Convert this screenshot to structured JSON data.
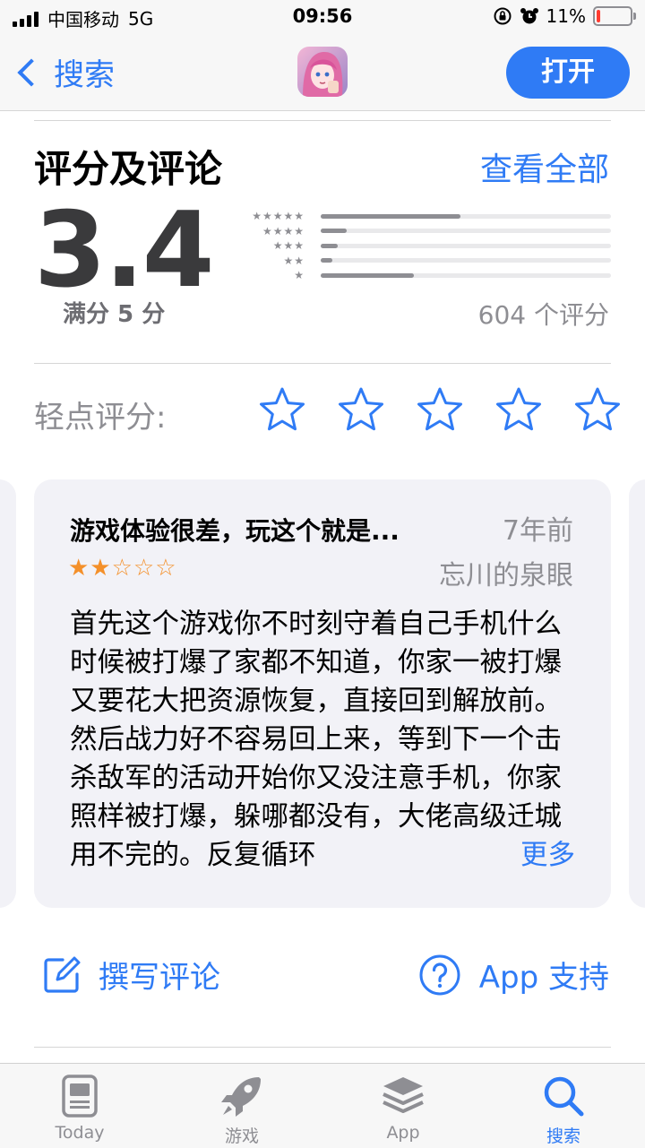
{
  "status_bar": {
    "carrier": "中国移动",
    "network": "5G",
    "time": "09:56",
    "battery": "11%",
    "battery_level": 0.11
  },
  "nav": {
    "back_label": "搜索",
    "open_label": "打开"
  },
  "ratings": {
    "title": "评分及评论",
    "see_all": "查看全部",
    "average": "3.4",
    "out_of": "满分 5 分",
    "count_label": "604 个评分",
    "distribution": [
      {
        "stars": "★★★★★",
        "fraction": 0.48
      },
      {
        "stars": "★★★★",
        "fraction": 0.09
      },
      {
        "stars": "★★★",
        "fraction": 0.06
      },
      {
        "stars": "★★",
        "fraction": 0.04
      },
      {
        "stars": "★",
        "fraction": 0.32
      }
    ]
  },
  "tap_to_rate": {
    "label": "轻点评分:",
    "star_count": 5
  },
  "review": {
    "title": "游戏体验很差，玩这个就是...",
    "date": "7年前",
    "stars": "★★☆☆☆",
    "author": "忘川的泉眼",
    "body": "首先这个游戏你不时刻守着自己手机什么时候被打爆了家都不知道，你家一被打爆又要花大把资源恢复，直接回到解放前。然后战力好不容易回上来，等到下一个击杀敌军的活动开始你又没注意手机，你家照样被打爆，躲哪都没有，大佬高级迁城用不完的。反复循环",
    "more_label": "更多"
  },
  "actions": {
    "write_review": "撰写评论",
    "app_support": "App 支持"
  },
  "tab_bar": {
    "items": [
      {
        "label": "Today",
        "icon": "today-icon"
      },
      {
        "label": "游戏",
        "icon": "rocket-icon"
      },
      {
        "label": "App",
        "icon": "layers-icon"
      },
      {
        "label": "搜索",
        "icon": "search-icon"
      }
    ],
    "active_index": 3
  },
  "colors": {
    "accent": "#2f7bf5",
    "review_star": "#f4902a",
    "battery_low": "#ff3b30"
  }
}
